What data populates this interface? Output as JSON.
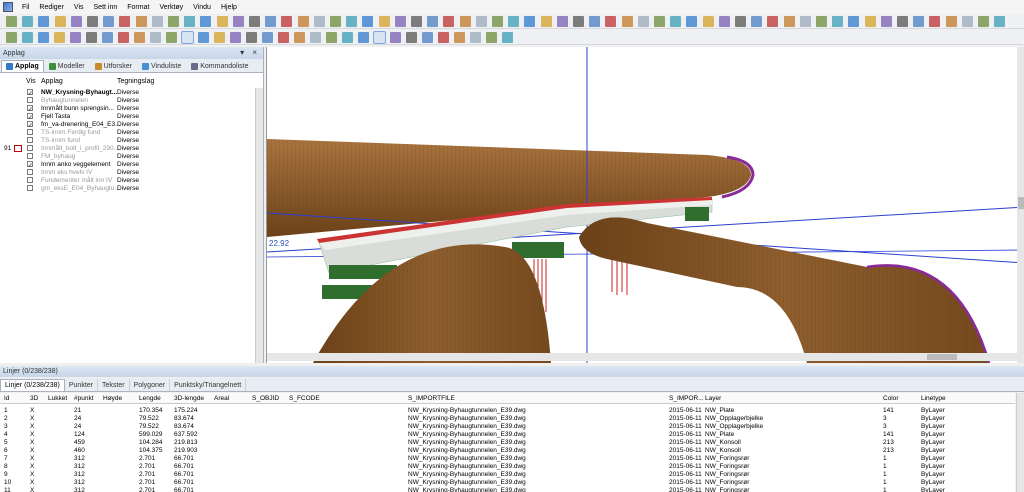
{
  "menu": [
    "Fil",
    "Rediger",
    "Vis",
    "Sett inn",
    "Format",
    "Verktøy",
    "Vindu",
    "Hjelp"
  ],
  "left_panel": {
    "title": "Applag",
    "close_glyph": "▾ ×",
    "tabs": [
      {
        "label": "Applag",
        "icon": "layers-icon",
        "color": "#2f7bc9"
      },
      {
        "label": "Modeller",
        "icon": "models-icon",
        "color": "#3d8f3d"
      },
      {
        "label": "Utforsker",
        "icon": "explorer-icon",
        "color": "#c98a2f"
      },
      {
        "label": "Vinduliste",
        "icon": "window-list-icon",
        "color": "#4a8ed6"
      },
      {
        "label": "Kommandoliste",
        "icon": "command-list-icon",
        "color": "#6a6a8a"
      }
    ],
    "headers": {
      "vis": "Vis",
      "applag": "Applag",
      "tegningslag": "Tegningslag"
    },
    "marker_label": "91",
    "layers": [
      {
        "name": "NW_Krysning-Byhaugt...",
        "layer": "Diverse",
        "checked": true,
        "dim": false,
        "bold": true
      },
      {
        "name": "Byhaugtunnelen",
        "layer": "Diverse",
        "checked": false,
        "dim": true,
        "bold": false
      },
      {
        "name": "Innmålt bunn sprengsin...",
        "layer": "Diverse",
        "checked": true,
        "dim": false,
        "bold": false
      },
      {
        "name": "Fjell Tasta",
        "layer": "Diverse",
        "checked": true,
        "dim": false,
        "bold": false
      },
      {
        "name": "fm_va-drenering_E04_E3...",
        "layer": "Diverse",
        "checked": true,
        "dim": false,
        "bold": false
      },
      {
        "name": "TS-innm Ferdig fund",
        "layer": "Diverse",
        "checked": false,
        "dim": true,
        "bold": false
      },
      {
        "name": "TS-innm fund",
        "layer": "Diverse",
        "checked": false,
        "dim": true,
        "bold": false
      },
      {
        "name": "Innmålt_bolt_i_profil_290...",
        "layer": "Diverse",
        "checked": false,
        "dim": true,
        "bold": false
      },
      {
        "name": "FM_byhaug",
        "layer": "Diverse",
        "checked": false,
        "dim": true,
        "bold": false
      },
      {
        "name": "Innm anko veggelement",
        "layer": "Diverse",
        "checked": true,
        "dim": false,
        "bold": false
      },
      {
        "name": "Innm eks hvelv IV",
        "layer": "Diverse",
        "checked": false,
        "dim": true,
        "bold": false
      },
      {
        "name": "Fundementer målt inn IV",
        "layer": "Diverse",
        "checked": false,
        "dim": true,
        "bold": false
      },
      {
        "name": "gm_eksE_E04_Byhaugtu...",
        "layer": "Diverse",
        "checked": false,
        "dim": true,
        "bold": false
      }
    ]
  },
  "viewport": {
    "label": "22.92"
  },
  "bottom_panel": {
    "title": "Linjer (0/238/238)",
    "tabs": [
      {
        "label": "Linjer (0/238/238)",
        "active": true
      },
      {
        "label": "Punkter",
        "active": false
      },
      {
        "label": "Tekster",
        "active": false
      },
      {
        "label": "Polygoner",
        "active": false
      },
      {
        "label": "Punktsky/Triangelnett",
        "active": false
      }
    ],
    "columns": [
      "Id",
      "3D",
      "Lukket",
      "#punkt",
      "Høyde",
      "Lengde",
      "3D-lengde",
      "Areal",
      "S_OBJID",
      "S_FCODE",
      "S_IMPORTFILE",
      "S_IMPOR...",
      "Layer",
      "Color",
      "Linetype"
    ],
    "rows": [
      [
        "1",
        "X",
        "",
        "21",
        "",
        "170.354",
        "175.224",
        "",
        "",
        "",
        "NW_Krysning-Byhaugtunnelen_E39.dwg",
        "2015-06-11",
        "NW_Plate",
        "141",
        "ByLayer"
      ],
      [
        "2",
        "X",
        "",
        "24",
        "",
        "79.522",
        "83.674",
        "",
        "",
        "",
        "NW_Krysning-Byhaugtunnelen_E39.dwg",
        "2015-06-11",
        "NW_Opplagerbjelke",
        "3",
        "ByLayer"
      ],
      [
        "3",
        "X",
        "",
        "24",
        "",
        "79.522",
        "83.674",
        "",
        "",
        "",
        "NW_Krysning-Byhaugtunnelen_E39.dwg",
        "2015-06-11",
        "NW_Opplagerbjelke",
        "3",
        "ByLayer"
      ],
      [
        "4",
        "X",
        "",
        "124",
        "",
        "599.029",
        "637.592",
        "",
        "",
        "",
        "NW_Krysning-Byhaugtunnelen_E39.dwg",
        "2015-06-11",
        "NW_Plate",
        "141",
        "ByLayer"
      ],
      [
        "5",
        "X",
        "",
        "459",
        "",
        "104.284",
        "219.813",
        "",
        "",
        "",
        "NW_Krysning-Byhaugtunnelen_E39.dwg",
        "2015-06-11",
        "NW_Konsoll",
        "213",
        "ByLayer"
      ],
      [
        "6",
        "X",
        "",
        "460",
        "",
        "104.375",
        "219.903",
        "",
        "",
        "",
        "NW_Krysning-Byhaugtunnelen_E39.dwg",
        "2015-06-11",
        "NW_Konsoll",
        "213",
        "ByLayer"
      ],
      [
        "7",
        "X",
        "",
        "312",
        "",
        "2.701",
        "66.701",
        "",
        "",
        "",
        "NW_Krysning-Byhaugtunnelen_E39.dwg",
        "2015-06-11",
        "NW_Foringsrør",
        "1",
        "ByLayer"
      ],
      [
        "8",
        "X",
        "",
        "312",
        "",
        "2.701",
        "66.701",
        "",
        "",
        "",
        "NW_Krysning-Byhaugtunnelen_E39.dwg",
        "2015-06-11",
        "NW_Foringsrør",
        "1",
        "ByLayer"
      ],
      [
        "9",
        "X",
        "",
        "312",
        "",
        "2.701",
        "66.701",
        "",
        "",
        "",
        "NW_Krysning-Byhaugtunnelen_E39.dwg",
        "2015-06-11",
        "NW_Foringsrør",
        "1",
        "ByLayer"
      ],
      [
        "10",
        "X",
        "",
        "312",
        "",
        "2.701",
        "66.701",
        "",
        "",
        "",
        "NW_Krysning-Byhaugtunnelen_E39.dwg",
        "2015-06-11",
        "NW_Foringsrør",
        "1",
        "ByLayer"
      ],
      [
        "11",
        "X",
        "",
        "312",
        "",
        "2.701",
        "66.701",
        "",
        "",
        "",
        "NW_Krysning-Byhaugtunnelen_E39.dwg",
        "2015-06-11",
        "NW_Foringsrør",
        "1",
        "ByLayer"
      ]
    ]
  }
}
